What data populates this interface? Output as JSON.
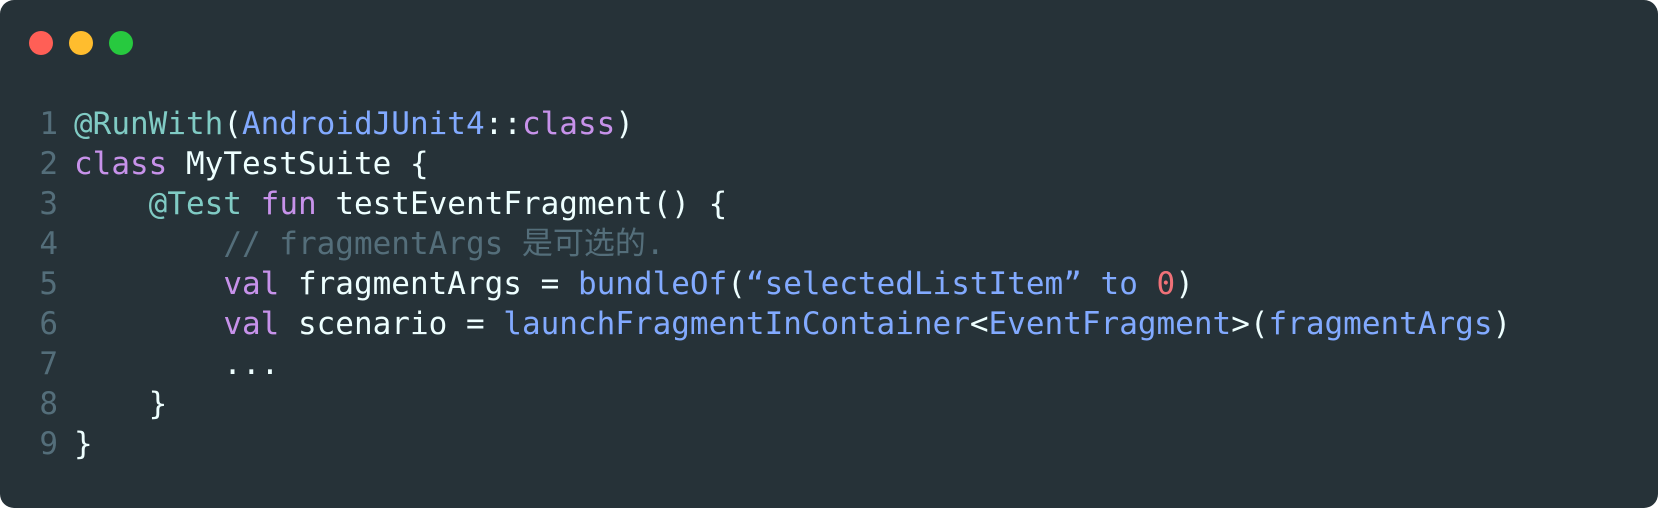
{
  "window": {
    "controls": [
      {
        "name": "close",
        "color": "#ff5f56"
      },
      {
        "name": "minimize",
        "color": "#ffbd2e"
      },
      {
        "name": "maximize",
        "color": "#27c93f"
      }
    ]
  },
  "colors": {
    "background": "#263238",
    "line_number": "#546e7a",
    "annotation": "#80cbc4",
    "keyword": "#c792ea",
    "type": "#82aaff",
    "plain": "#eeffff",
    "comment": "#546e7a",
    "number": "#f07178"
  },
  "code": {
    "lines": [
      {
        "number": "1",
        "tokens": [
          {
            "text": "@RunWith",
            "kind": "annotation"
          },
          {
            "text": "(",
            "kind": "plain"
          },
          {
            "text": "AndroidJUnit4",
            "kind": "type"
          },
          {
            "text": "::",
            "kind": "plain"
          },
          {
            "text": "class",
            "kind": "keyword"
          },
          {
            "text": ")",
            "kind": "plain"
          }
        ]
      },
      {
        "number": "2",
        "tokens": [
          {
            "text": "class",
            "kind": "keyword"
          },
          {
            "text": " MyTestSuite {",
            "kind": "plain"
          }
        ]
      },
      {
        "number": "3",
        "tokens": [
          {
            "text": "    ",
            "kind": "plain"
          },
          {
            "text": "@Test",
            "kind": "annotation"
          },
          {
            "text": " ",
            "kind": "plain"
          },
          {
            "text": "fun",
            "kind": "keyword"
          },
          {
            "text": " testEventFragment() {",
            "kind": "plain"
          }
        ]
      },
      {
        "number": "4",
        "tokens": [
          {
            "text": "        ",
            "kind": "plain"
          },
          {
            "text": "// fragmentArgs 是可选的.",
            "kind": "comment"
          }
        ]
      },
      {
        "number": "5",
        "tokens": [
          {
            "text": "        ",
            "kind": "plain"
          },
          {
            "text": "val",
            "kind": "keyword"
          },
          {
            "text": " fragmentArgs = ",
            "kind": "plain"
          },
          {
            "text": "bundleOf",
            "kind": "func"
          },
          {
            "text": "(",
            "kind": "plain"
          },
          {
            "text": "“selectedListItem” to ",
            "kind": "string"
          },
          {
            "text": "0",
            "kind": "number"
          },
          {
            "text": ")",
            "kind": "plain"
          }
        ]
      },
      {
        "number": "6",
        "tokens": [
          {
            "text": "        ",
            "kind": "plain"
          },
          {
            "text": "val",
            "kind": "keyword"
          },
          {
            "text": " scenario = ",
            "kind": "plain"
          },
          {
            "text": "launchFragmentInContainer",
            "kind": "func"
          },
          {
            "text": "<",
            "kind": "plain"
          },
          {
            "text": "EventFragment",
            "kind": "type"
          },
          {
            "text": ">(",
            "kind": "plain"
          },
          {
            "text": "fragmentArgs",
            "kind": "type"
          },
          {
            "text": ")",
            "kind": "plain"
          }
        ]
      },
      {
        "number": "7",
        "tokens": [
          {
            "text": "        ...",
            "kind": "plain"
          }
        ]
      },
      {
        "number": "8",
        "tokens": [
          {
            "text": "    }",
            "kind": "plain"
          }
        ]
      },
      {
        "number": "9",
        "tokens": [
          {
            "text": "}",
            "kind": "plain"
          }
        ]
      }
    ]
  }
}
